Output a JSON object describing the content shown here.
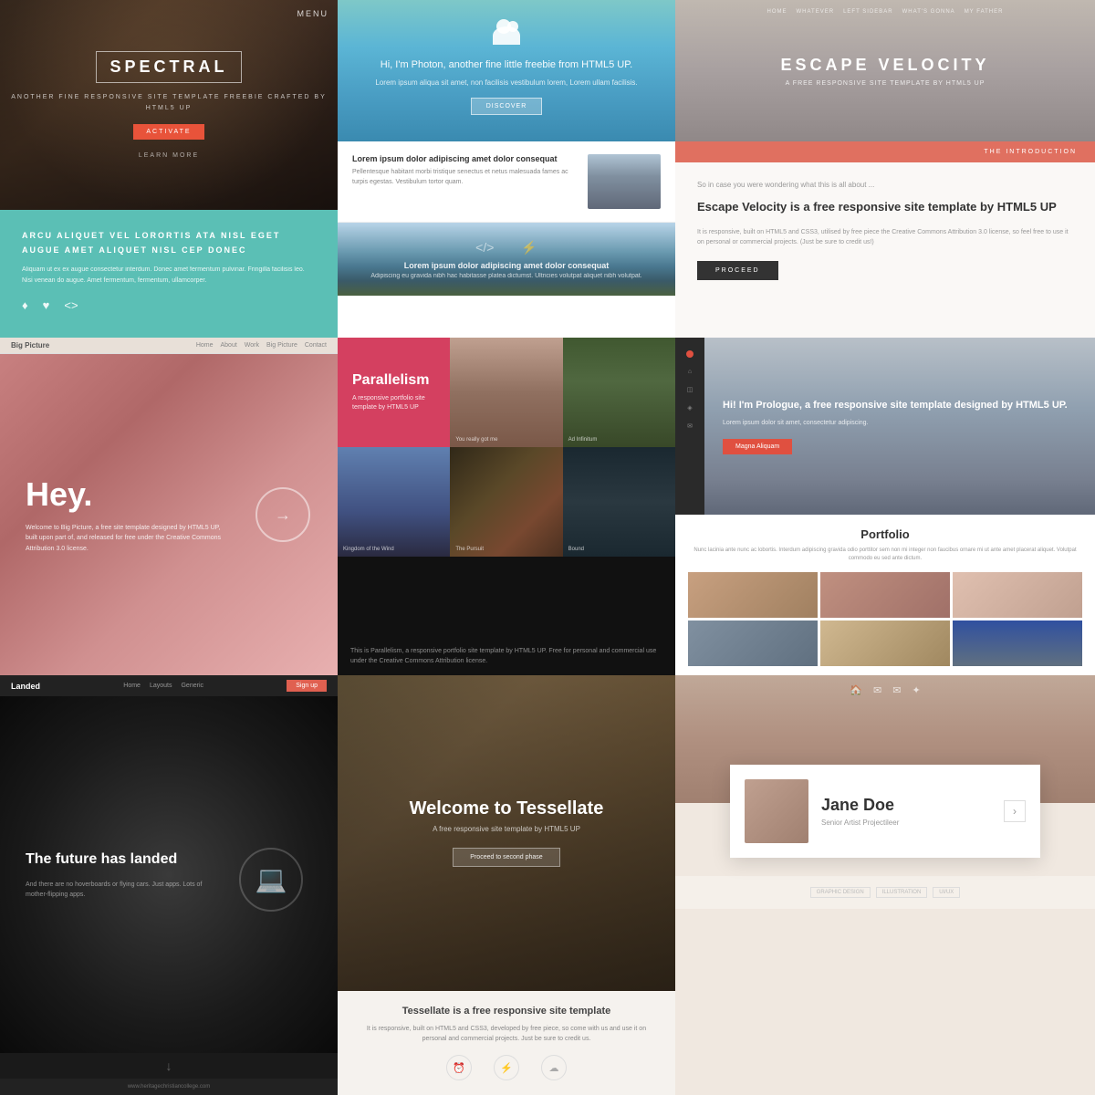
{
  "cells": {
    "spectral": {
      "menu_label": "MENU",
      "title": "SPECTRAL",
      "subtitle": "ANOTHER FINE RESPONSIVE\nSITE TEMPLATE FREEBIE\nCRAFTED BY HTML5 UP",
      "activate_btn": "ACTIVATE",
      "learn_more": "LEARN MORE",
      "teal_heading": "ARCU ALIQUET VEL LORORTIS ATA NISL\nEGET AUGUE AMET ALIQUET NISL CEP DONEC",
      "teal_text": "Aliquam ut ex ex augue consectetur interdum. Donec amet fermentum pulvinar. Fringilla facilisis leo. Nisi venean do augue. Amet fermentum, fermentum, ullamcorper.",
      "icon1": "♦",
      "icon2": "♥",
      "icon3": "<>"
    },
    "photon": {
      "cloud_icon": "☁",
      "greeting": "Hi, I'm Photon, another fine little freebie from HTML5 UP.",
      "subtitle": "Lorem ipsum aliqua sit amet, non facilisis vestibulum lorem, Lorem ullam facilisis.",
      "discover_btn": "DISCOVER",
      "section1_title": "Lorem ipsum dolor adipiscing amet dolor consequat",
      "section1_text": "Pellentesque habitant morbi tristique senectus et netus malesuada fames ac turpis egestas. Vestibulum tortor quam.",
      "section2_title": "Lorem ipsum dolor adipiscing amet dolor consequat",
      "section2_text": "Adipiscing eu gravida nibh hac habitasse platea dictumst. Ultricies volutpat aliquet nibh volutpat.",
      "code_icon": "</>",
      "bolt_icon": "⚡"
    },
    "escape": {
      "nav_items": [
        "HOME",
        "WHATEVER",
        "LEFT SIDEBAR",
        "WHAT'S GONNA",
        "MY FATHER"
      ],
      "title": "ESCAPE VELOCITY",
      "subtitle": "A FREE RESPONSIVE SITE TEMPLATE BY HTML5 UP",
      "intro_label": "THE INTRODUCTION",
      "so_in_case": "So in case you were wondering what this is all about ...",
      "main_text": "Escape Velocity is a free responsive site template by HTML5 UP",
      "by_text": "It is responsive, built on HTML5 and CSS3, utilised by free piece the Creative Commons Attribution 3.0 license, so feel free to use it on personal or commercial projects. (Just be sure to credit us!)",
      "proceed_btn": "PROCEED"
    },
    "bigpicture": {
      "logo": "Big Picture",
      "nav_items": [
        "Home",
        "About",
        "Work",
        "Big Picture",
        "Contact"
      ],
      "hey_text": "Hey.",
      "description": "Welcome to Big Picture, a free site template designed by HTML5 UP, built upon part of, and released for free under the Creative Commons Attribution 3.0 license.",
      "circle_arrow": "→"
    },
    "parallelism": {
      "title": "Parallelism",
      "subtitle": "A responsive portfolio site\ntemplate by HTML5 UP",
      "img1_label": "You really got me",
      "img2_label": "Ad Infinitum",
      "img3_label": "Kingdom of the Wind",
      "img4_label": "The Pursuit",
      "img5_label": "Bound",
      "bottom_text": "This is Parallelism, a responsive portfolio site template by HTML5 UP. Free for personal and commercial use under the Creative Commons Attribution license."
    },
    "prologue": {
      "title": "Hi! I'm Prologue, a free responsive site template designed by HTML5 UP.",
      "description": "Lorem ipsum dolor sit amet, consectetur adipiscing.",
      "btn_label": "Magna Aliquam",
      "portfolio_title": "Portfolio",
      "portfolio_desc": "Nunc lacinia ante nunc ac lobortis. Interdum adipiscing gravida odio porttitor sem non mi integer non faucibus ornare mi ut ante amet placerat aliquet. Volutpat commodo eu sed ante dictum."
    },
    "landed": {
      "logo": "Landed",
      "nav_items": [
        "Home",
        "Layouts",
        "Generic",
        "Sign Up"
      ],
      "signup_btn": "Sign up",
      "title": "The future has landed",
      "subtitle": "And there are no hoverboards or flying cars. Just apps. Lots of mother-flipping apps.",
      "arrow": "↓"
    },
    "tessellate": {
      "title": "Welcome to Tessellate",
      "subtitle": "A free responsive site template by HTML5 UP",
      "btn_label": "Proceed to second phase",
      "content_title": "Tessellate is a free responsive site template",
      "content_text": "It is responsive, built on HTML5 and CSS3, developed by free piece, so come with us and use it on personal and commercial projects. Just be sure to credit us.",
      "icon1": "⏰",
      "icon2": "⚡",
      "icon3": "☁"
    },
    "miniport": {
      "nav_icons": [
        "🏠",
        "✉",
        "✉",
        "✦"
      ],
      "name": "Jane Doe",
      "role": "Senior Artist Projectileer",
      "arrow": "›",
      "tags": [
        "GRAPHIC DESIGN",
        "ILLUSTRATION",
        "UI/UX"
      ]
    }
  }
}
